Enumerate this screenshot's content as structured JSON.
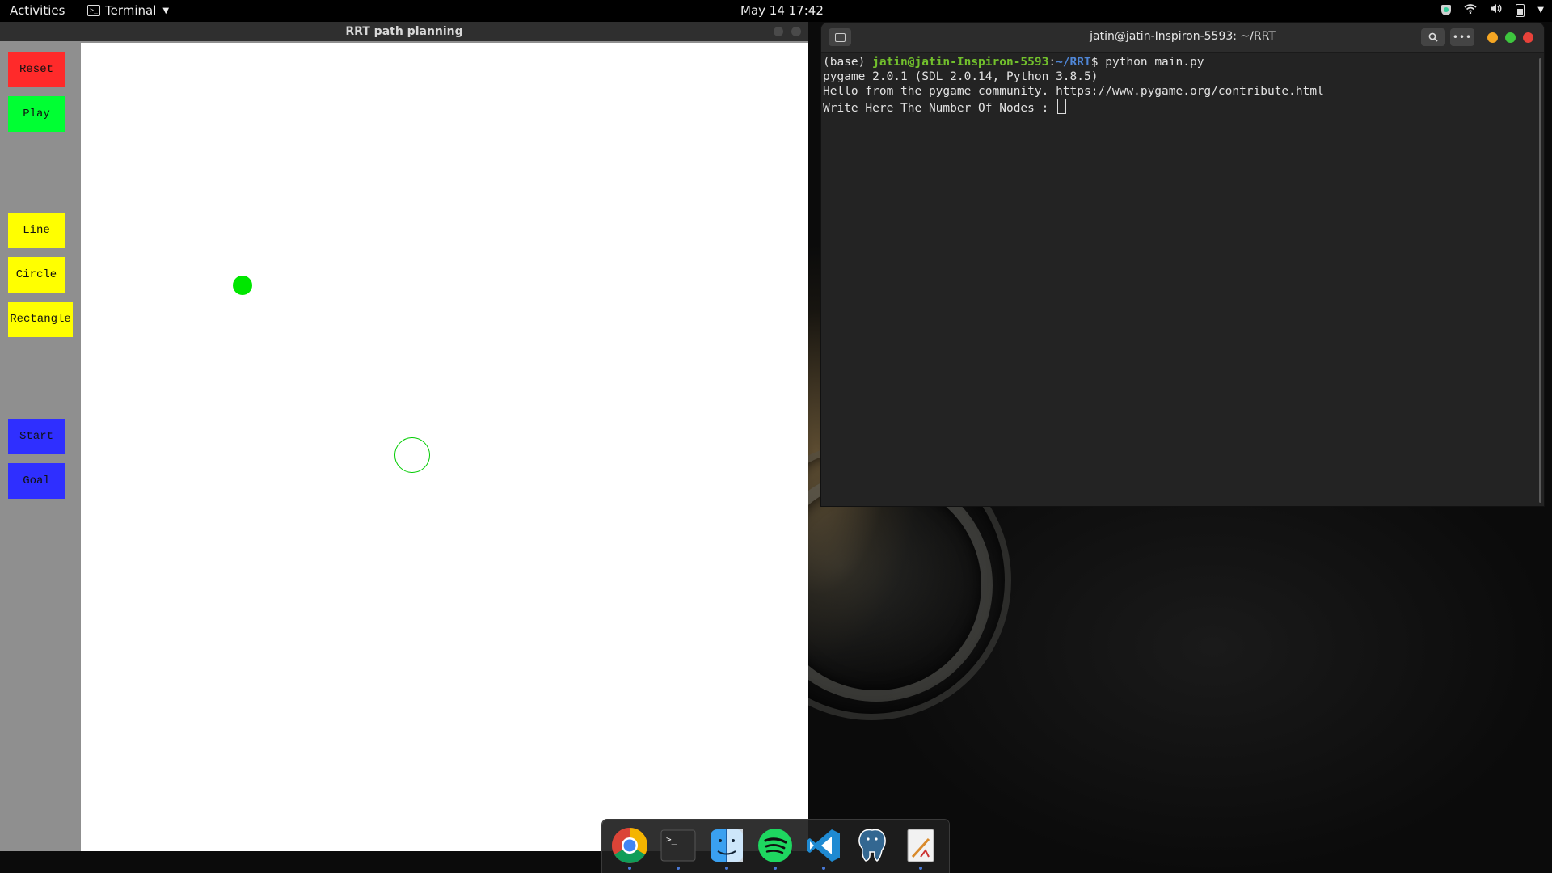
{
  "topbar": {
    "activities": "Activities",
    "app_name": "Terminal",
    "clock": "May 14  17:42",
    "icons": [
      "shield-icon",
      "wifi-icon",
      "volume-icon",
      "battery-icon",
      "caret-down-icon"
    ]
  },
  "rrt_window": {
    "title": "RRT path planning",
    "buttons": {
      "reset": "Reset",
      "play": "Play",
      "line": "Line",
      "circle": "Circle",
      "rectangle": "Rectangle",
      "start": "Start",
      "goal": "Goal"
    },
    "colors": {
      "reset": "#ff2a2a",
      "play": "#00ff33",
      "shape": "#ffff00",
      "marker": "#2f2fff",
      "start_point": "#00e600",
      "goal_point": "#00cc00"
    }
  },
  "terminal": {
    "title": "jatin@jatin-Inspiron-5593: ~/RRT",
    "prompt_env": "(base) ",
    "prompt_user": "jatin@jatin-Inspiron-5593",
    "prompt_sep": ":",
    "prompt_path": "~/RRT",
    "prompt_symbol": "$ ",
    "command": "python main.py",
    "output": [
      "pygame 2.0.1 (SDL 2.0.14, Python 3.8.5)",
      "Hello from the pygame community. https://www.pygame.org/contribute.html",
      "Write Here The Number Of Nodes : "
    ],
    "window_buttons_colors": {
      "minimize": "#f5a623",
      "maximize": "#3ec63e",
      "close": "#e8423a"
    }
  },
  "dock": {
    "apps": [
      "chrome-icon",
      "terminal-icon",
      "finder-icon",
      "spotify-icon",
      "vscode-icon",
      "postgres-icon",
      "text-editor-icon"
    ]
  }
}
